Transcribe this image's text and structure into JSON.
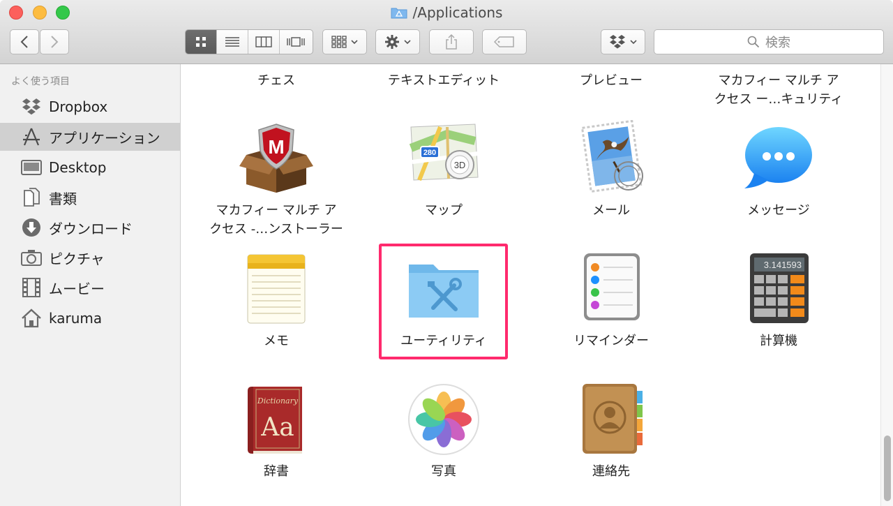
{
  "window": {
    "title": "/Applications"
  },
  "toolbar": {
    "search_placeholder": "検索"
  },
  "sidebar": {
    "header": "よく使う項目",
    "items": [
      {
        "label": "Dropbox",
        "icon": "dropbox-icon"
      },
      {
        "label": "アプリケーション",
        "icon": "applications-icon",
        "selected": true
      },
      {
        "label": "Desktop",
        "icon": "desktop-icon"
      },
      {
        "label": "書類",
        "icon": "documents-icon"
      },
      {
        "label": "ダウンロード",
        "icon": "downloads-icon"
      },
      {
        "label": "ピクチャ",
        "icon": "camera-icon"
      },
      {
        "label": "ムービー",
        "icon": "film-icon"
      },
      {
        "label": "karuma",
        "icon": "home-icon"
      }
    ]
  },
  "files": {
    "top_labels": [
      "チェス",
      "テキストエディット",
      "プレビュー",
      "マカフィー マルチ ア\nクセス ー…キュリティ"
    ],
    "row1": [
      "マカフィー マルチ ア\nクセス -…ンストーラー",
      "マップ",
      "メール",
      "メッセージ"
    ],
    "row2": [
      "メモ",
      "ユーティリティ",
      "リマインダー",
      "計算機"
    ],
    "row3": [
      "辞書",
      "写真",
      "連絡先"
    ]
  },
  "calculator_display": "3.141593",
  "dictionary_cover": {
    "title": "Dictionary",
    "letters": "Aa"
  },
  "maps_sign": "280",
  "maps_badge": "3D",
  "colors": {
    "highlight": "#ff2a6d",
    "selection": "#d0d0d0"
  }
}
